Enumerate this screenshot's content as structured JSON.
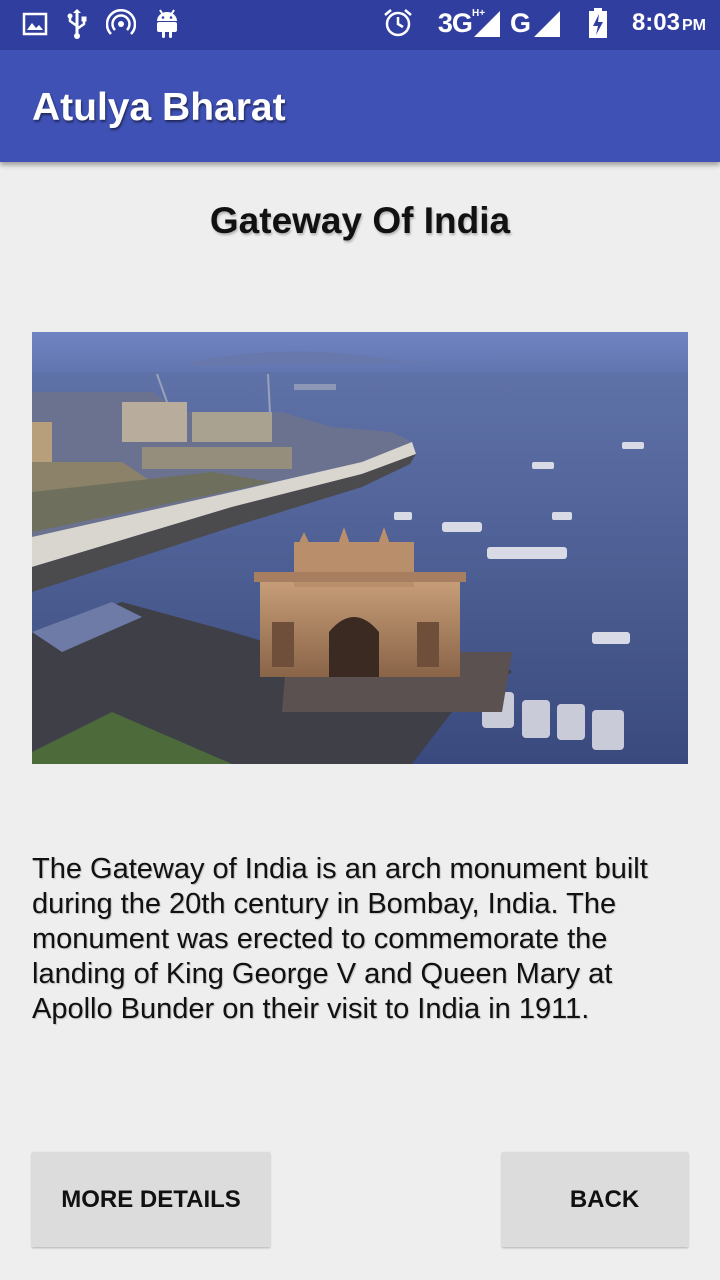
{
  "status_bar": {
    "icons_left": [
      "image-icon",
      "usb-icon",
      "hotspot-icon",
      "android-icon"
    ],
    "icons_right": [
      "alarm-icon",
      "signal-icon",
      "battery-charging-icon"
    ],
    "network_1": "3G",
    "network_2": "G",
    "time": "8:03",
    "ampm": "PM"
  },
  "app_bar": {
    "title": "Atulya Bharat"
  },
  "page": {
    "title": "Gateway Of India",
    "image_alt": "Gateway of India aerial view",
    "description": "The Gateway of India is an arch monument built during the 20th century in Bombay, India. The monument was erected to commemorate the landing of King George V and Queen Mary at Apollo Bunder on their visit to India in 1911."
  },
  "buttons": {
    "more_details": "MORE DETAILS",
    "back": "BACK"
  }
}
